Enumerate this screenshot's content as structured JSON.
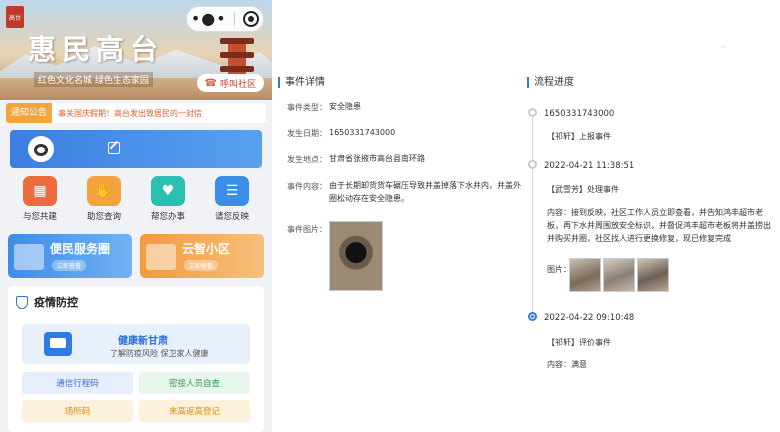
{
  "phone": {
    "banner": {
      "logo_text": "高台",
      "title": "惠民高台",
      "subtitle": "红色文化名城 绿色生态家园",
      "call_button": "呼叫社区"
    },
    "notice": {
      "tag": "通知公告",
      "text": "事关国庆假期！高台发出致居民的一封信"
    },
    "grid": [
      {
        "label": "与您共建",
        "color": "#ee6b3b",
        "icon": "building-icon"
      },
      {
        "label": "助您查询",
        "color": "#f4a23c",
        "icon": "hand-search-icon"
      },
      {
        "label": "帮您办事",
        "color": "#29c0b1",
        "icon": "heart-hands-icon"
      },
      {
        "label": "请您反映",
        "color": "#3a8ee6",
        "icon": "message-icon"
      }
    ],
    "cards": [
      {
        "title": "便民服务圈",
        "pill": "立即查看",
        "color": "#3d8de8"
      },
      {
        "title": "云智小区",
        "pill": "立即查看",
        "color": "#f29a3e"
      }
    ],
    "epidemic": {
      "title": "疫情防控",
      "health_title": "健康新甘肃",
      "health_sub": "了解防疫风险 保卫家人健康",
      "buttons": [
        {
          "label": "通信行程码",
          "bg": "#e6eefb",
          "color": "#3a6fd8"
        },
        {
          "label": "密接人员自查",
          "bg": "#e8f6ec",
          "color": "#2e9b55"
        },
        {
          "label": "场所码",
          "bg": "#fdf1dc",
          "color": "#d98a1a"
        },
        {
          "label": "来高返高登记",
          "bg": "#fdf1dc",
          "color": "#d98a1a"
        }
      ]
    }
  },
  "detail": {
    "section_title": "事件详情",
    "fields": [
      {
        "label": "事件类型：",
        "value": "安全隐患"
      },
      {
        "label": "发生日期：",
        "value": "1650331743000"
      },
      {
        "label": "发生地点：",
        "value": "甘肃省张掖市高台县南环路"
      },
      {
        "label": "事件内容：",
        "value": "由于长期卸货货车碾压导致井盖掉落下水井内，井盖外圈松动存在安全隐患。"
      },
      {
        "label": "事件图片：",
        "value": ""
      }
    ]
  },
  "progress": {
    "section_title": "流程进度",
    "steps": [
      {
        "date": "1650331743000",
        "actor": "【祁轩】上报事件",
        "content": ""
      },
      {
        "date": "2022-04-21 11:38:51",
        "actor": "【武雪芳】处理事件",
        "content": "内容：接到反映，社区工作人员立即查看，并告知鸿丰超市老板，再下水井周围放安全标识，并督促鸿丰超市老板将井盖捞出并购买井圈，社区找人进行更换修复，现已修复完成",
        "images_label": "图片："
      },
      {
        "date": "2022-04-22 09:10:48",
        "actor": "【祁轩】评价事件",
        "content": "内容：满意"
      }
    ]
  }
}
